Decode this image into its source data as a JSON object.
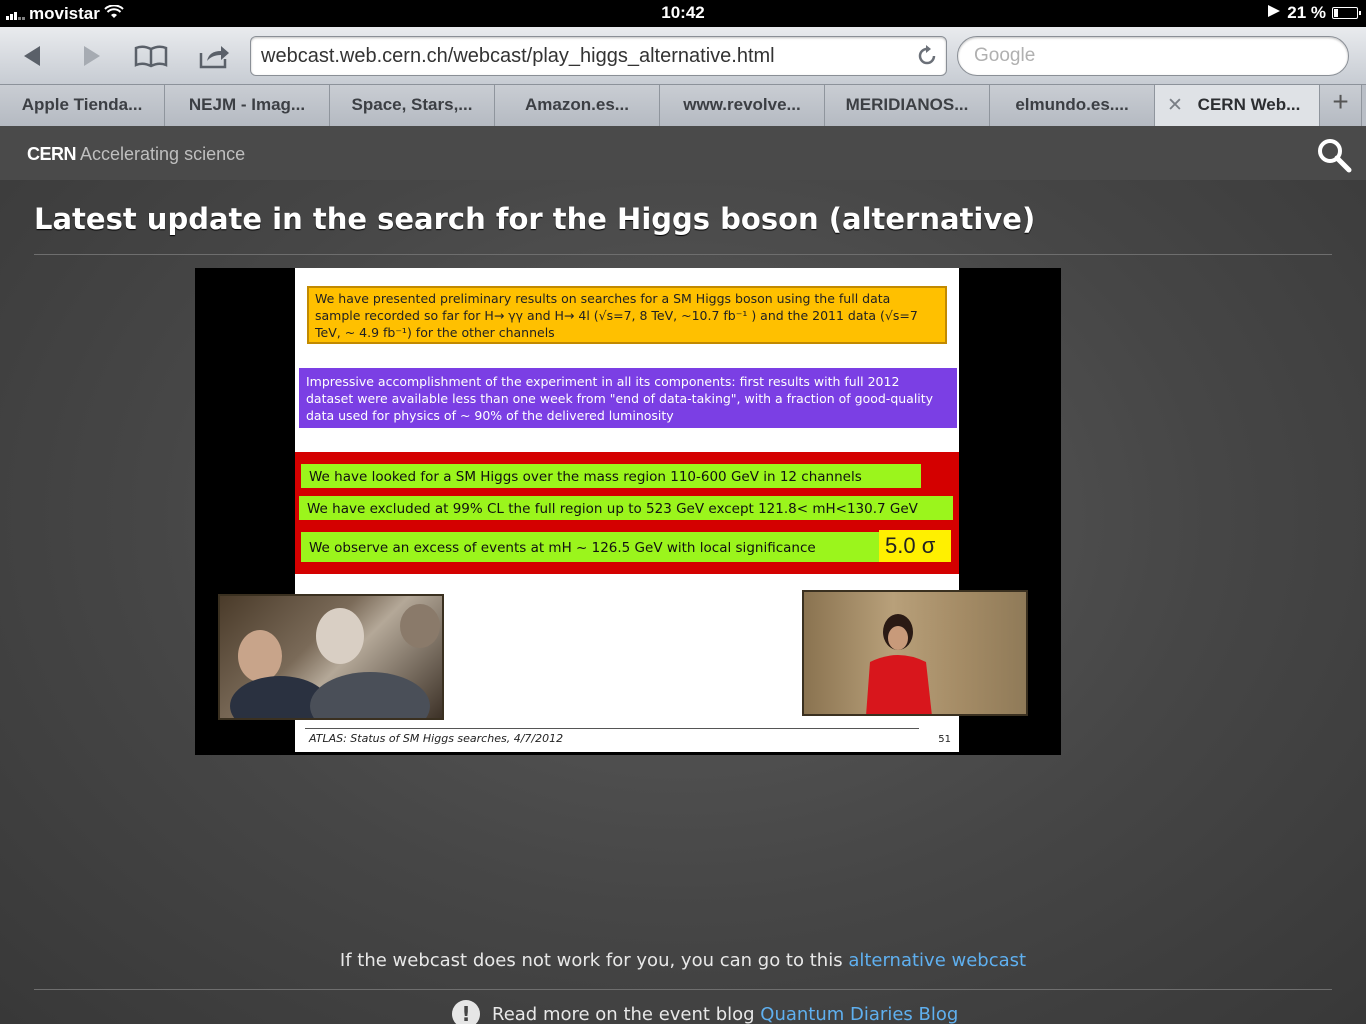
{
  "status_bar": {
    "carrier": "movistar",
    "time": "10:42",
    "battery_text": "21 %",
    "battery_level": 0.21
  },
  "toolbar": {
    "url": "webcast.web.cern.ch/webcast/play_higgs_alternative.html",
    "search_placeholder": "Google",
    "icons": [
      "back-icon",
      "forward-icon",
      "bookmarks-icon",
      "share-icon",
      "reload-icon"
    ]
  },
  "tabs": [
    {
      "label": "Apple Tienda..."
    },
    {
      "label": "NEJM - Imag..."
    },
    {
      "label": "Space, Stars,..."
    },
    {
      "label": "Amazon.es..."
    },
    {
      "label": "www.revolve..."
    },
    {
      "label": "MERIDIANOS..."
    },
    {
      "label": "elmundo.es...."
    },
    {
      "label": "CERN Web...",
      "active": true
    }
  ],
  "tab_add": "+",
  "cern": {
    "brand": "CERN",
    "tagline": "Accelerating science"
  },
  "page": {
    "title": "Latest update in the search for the Higgs boson (alternative)",
    "note_prefix": "If the webcast does not work for you, you can go to this",
    "note_link": "alternative webcast",
    "blog_prefix": "Read more on the event blog",
    "blog_link": "Quantum Diaries Blog"
  },
  "slide": {
    "yellow_text": "We have presented preliminary results on searches for a SM Higgs boson using the full data sample recorded so far for H→ γγ and H→ 4l (√s=7, 8 TeV, ~10.7 fb⁻¹ ) and the 2011 data (√s=7 TeV, ~ 4.9 fb⁻¹) for the other channels",
    "purple_text": "Impressive accomplishment of the experiment in all its components: first results with full 2012 dataset were available less than one week from \"end of data-taking\", with a fraction of good-quality data used for physics of ~ 90% of the delivered luminosity",
    "green_1": "We have looked for a SM Higgs over the mass region 110-600 GeV in 12 channels",
    "green_2": "We have excluded at 99% CL the full region up to 523 GeV except 121.8< mH<130.7 GeV",
    "green_3": "We observe an excess of events at mH ~ 126.5 GeV with local significance",
    "significance": "5.0 σ",
    "footer": "ATLAS: Status of SM Higgs searches, 4/7/2012",
    "page_number": "51"
  },
  "colors": {
    "link": "#5fb0f0",
    "slide_yellow": "#ffc000",
    "slide_purple": "#7b3fe4",
    "slide_red": "#d40000",
    "slide_green": "#9bf51c"
  }
}
